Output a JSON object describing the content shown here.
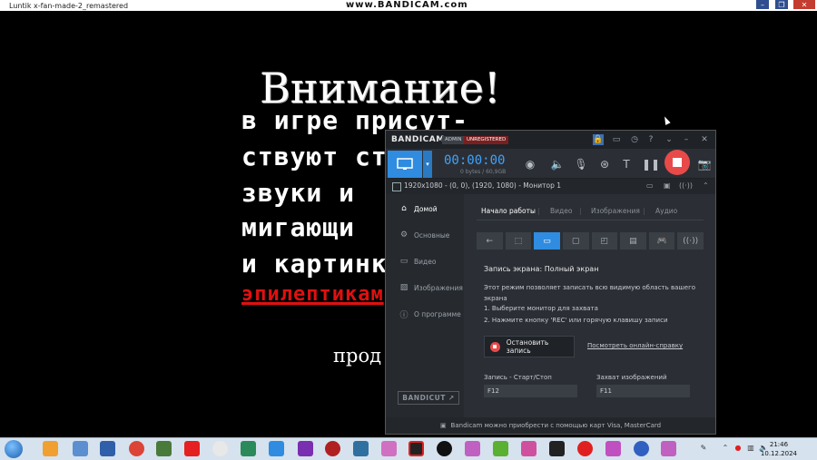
{
  "game_window": {
    "title": "Luntik x-fan-made-2_remastered",
    "watermark": "www.BANDICAM.com",
    "warning": {
      "title": "Внимание!",
      "lines": [
        "в игре присут-",
        "ствуют ст",
        "звуки и",
        "мигающи",
        "и картинк"
      ],
      "red_line": "эпилептикам",
      "continue": "прод"
    }
  },
  "bandicam": {
    "logo": "BANDICAM",
    "badges": [
      "ADMIN",
      "UNREGISTERED"
    ],
    "timer": "00:00:00",
    "size": "0 bytes / 60,9GB",
    "info_bar": "1920x1080 - (0, 0), (1920, 1080) - Монитор 1",
    "sidebar": [
      {
        "label": "Домой",
        "icon": "home-icon",
        "active": true
      },
      {
        "label": "Основные",
        "icon": "gear-icon",
        "active": false
      },
      {
        "label": "Видео",
        "icon": "video-icon",
        "active": false
      },
      {
        "label": "Изображения",
        "icon": "image-icon",
        "active": false
      },
      {
        "label": "О программе",
        "icon": "info-icon",
        "active": false
      }
    ],
    "bandicut": "BANDICUT ↗",
    "tabs": [
      "Начало работы",
      "Видео",
      "Изображения",
      "Аудио"
    ],
    "heading": "Запись экрана: Полный экран",
    "description": "Этот режим позволяет записать всю видимую область вашего экрана",
    "steps": [
      "1. Выберите монитор для захвата",
      "2. Нажмите кнопку 'REC' или горячую клавишу записи"
    ],
    "stop_button": "Остановить запись",
    "help_link": "Посмотреть онлайн-справку",
    "hotkeys": [
      {
        "label": "Запись - Старт/Стоп",
        "value": "F12"
      },
      {
        "label": "Захват изображений",
        "value": "F11"
      }
    ],
    "footer": "Bandicam можно приобрести с помощью карт Visa, MasterCard",
    "accent": "#2f8ce0",
    "rec_color": "#e84a4a"
  },
  "taskbar": {
    "time": "21:46",
    "date": "10.12.2024"
  }
}
